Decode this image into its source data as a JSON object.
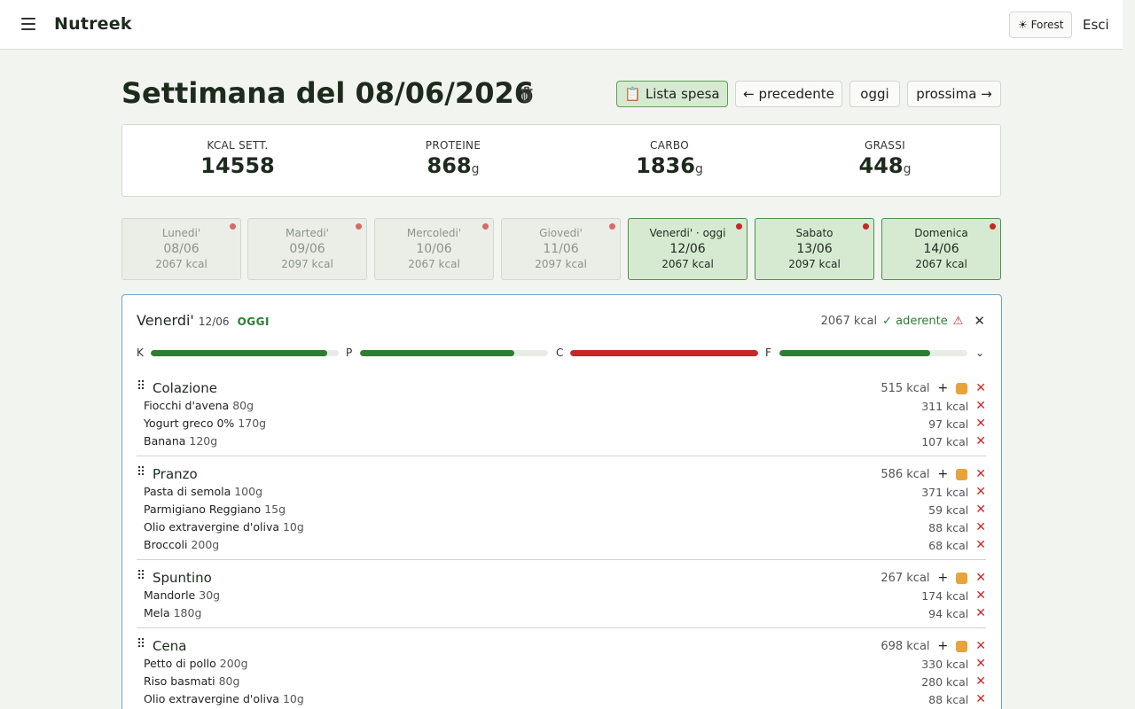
{
  "app": {
    "name": "Nutreek",
    "theme_label": "☀ Forest",
    "logout_label": "Esci"
  },
  "header": {
    "title": "Settimana del 08/06/2026",
    "shopping_label": "📋 Lista spesa",
    "prev_label": "← precedente",
    "today_label": "oggi",
    "next_label": "prossima →"
  },
  "stats": [
    {
      "label": "KCAL SETT.",
      "value": "14558",
      "unit": ""
    },
    {
      "label": "PROTEINE",
      "value": "868",
      "unit": "g"
    },
    {
      "label": "CARBO",
      "value": "1836",
      "unit": "g"
    },
    {
      "label": "GRASSI",
      "value": "448",
      "unit": "g"
    }
  ],
  "days": [
    {
      "name": "Lunedi'",
      "date": "08/06",
      "kcal": "2067 kcal"
    },
    {
      "name": "Martedi'",
      "date": "09/06",
      "kcal": "2097 kcal"
    },
    {
      "name": "Mercoledi'",
      "date": "10/06",
      "kcal": "2067 kcal"
    },
    {
      "name": "Giovedi'",
      "date": "11/06",
      "kcal": "2097 kcal"
    },
    {
      "name": "Venerdi' · oggi",
      "date": "12/06",
      "kcal": "2067 kcal"
    },
    {
      "name": "Sabato",
      "date": "13/06",
      "kcal": "2097 kcal"
    },
    {
      "name": "Domenica",
      "date": "14/06",
      "kcal": "2067 kcal"
    }
  ],
  "detail": {
    "day": "Venerdi'",
    "date": "12/06",
    "today_tag": "OGGI",
    "kcal": "2067 kcal",
    "adherence": "✓ aderente",
    "warning": "⚠",
    "macros": [
      {
        "label": "K",
        "pct": 0.94,
        "over": false
      },
      {
        "label": "P",
        "pct": 0.82,
        "over": false
      },
      {
        "label": "C",
        "pct": 1.0,
        "over": true
      },
      {
        "label": "F",
        "pct": 0.8,
        "over": false
      }
    ],
    "meals": [
      {
        "name": "Colazione",
        "kcal": "515 kcal",
        "foods": [
          {
            "name": "Fiocchi d'avena",
            "qty": "80g",
            "kcal": "311 kcal"
          },
          {
            "name": "Yogurt greco 0%",
            "qty": "170g",
            "kcal": "97 kcal"
          },
          {
            "name": "Banana",
            "qty": "120g",
            "kcal": "107 kcal"
          }
        ]
      },
      {
        "name": "Pranzo",
        "kcal": "586 kcal",
        "foods": [
          {
            "name": "Pasta di semola",
            "qty": "100g",
            "kcal": "371 kcal"
          },
          {
            "name": "Parmigiano Reggiano",
            "qty": "15g",
            "kcal": "59 kcal"
          },
          {
            "name": "Olio extravergine d'oliva",
            "qty": "10g",
            "kcal": "88 kcal"
          },
          {
            "name": "Broccoli",
            "qty": "200g",
            "kcal": "68 kcal"
          }
        ]
      },
      {
        "name": "Spuntino",
        "kcal": "267 kcal",
        "foods": [
          {
            "name": "Mandorle",
            "qty": "30g",
            "kcal": "174 kcal"
          },
          {
            "name": "Mela",
            "qty": "180g",
            "kcal": "94 kcal"
          }
        ]
      },
      {
        "name": "Cena",
        "kcal": "698 kcal",
        "foods": [
          {
            "name": "Petto di pollo",
            "qty": "200g",
            "kcal": "330 kcal"
          },
          {
            "name": "Riso basmati",
            "qty": "80g",
            "kcal": "280 kcal"
          },
          {
            "name": "Olio extravergine d'oliva",
            "qty": "10g",
            "kcal": "88 kcal"
          }
        ]
      }
    ]
  }
}
